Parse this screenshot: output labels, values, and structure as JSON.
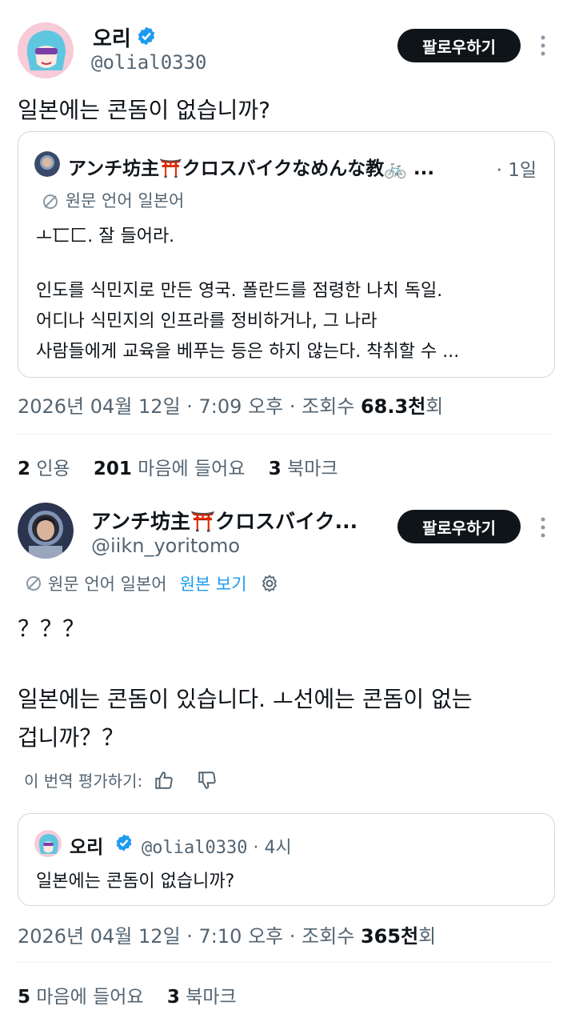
{
  "tweet1": {
    "author_name": "오리",
    "author_handle": "@olial0330",
    "follow_label": "팔로우하기",
    "text": "일본에는 콘돔이 없습니까?",
    "quote": {
      "author_name": "アンチ坊主⛩️クロスバイクなめんな教🚲 ...",
      "time": "· 1일",
      "source_language": "원문 언어 일본어",
      "line1": "ㅗ匸匚. 잘 들어라.",
      "line2": "인도를 식민지로 만든 영국. 폴란드를 점령한 나치 독일.",
      "line3": "어디나 식민지의 인프라를 정비하거나, 그 나라",
      "line4": "사람들에게 교육을 베푸는 등은 하지 않는다. 착취할 수 ..."
    },
    "meta_time": "2026년 04월 12일 · 7:09 오후 · 조회수 ",
    "meta_views": "68.3천",
    "meta_views_suffix": "회",
    "stats": {
      "quotes_count": "2",
      "quotes_label": "인용",
      "likes_count": "201",
      "likes_label": "마음에 들어요",
      "bookmarks_count": "3",
      "bookmarks_label": "북마크"
    }
  },
  "tweet2": {
    "author_name": "アンチ坊主⛩️クロスバイク...",
    "author_handle": "@iikn_yoritomo",
    "follow_label": "팔로우하기",
    "source_language": "원문 언어 일본어",
    "view_original": "원본 보기",
    "text_line1": "？？？",
    "text_line2": "일본에는 콘돔이 있습니다. ㅗ선에는 콘돔이 없는",
    "text_line3": "겁니까？？",
    "rate_translation": "이 번역 평가하기:",
    "quote": {
      "author_name": "오리",
      "author_handle": "@olial0330",
      "time": "· 4시",
      "text": "일본에는 콘돔이 없습니까?"
    },
    "meta_time": "2026년 04월 12일 · 7:10 오후 · 조회수 ",
    "meta_views": "365천",
    "meta_views_suffix": "회",
    "stats": {
      "likes_count": "5",
      "likes_label": "마음에 들어요",
      "bookmarks_count": "3",
      "bookmarks_label": "북마크"
    }
  },
  "colors": {
    "verified": "#1d9bf0",
    "link": "#1d9bf0",
    "gray": "#536471"
  }
}
